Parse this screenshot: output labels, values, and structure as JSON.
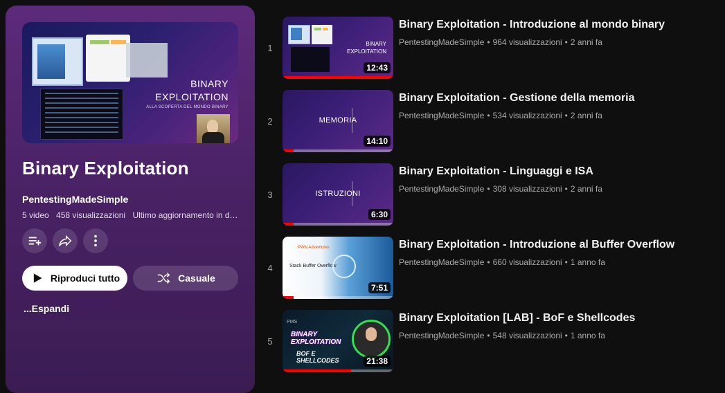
{
  "playlist": {
    "title": "Binary Exploitation",
    "channel": "PentestingMadeSimple",
    "video_count": "5 video",
    "views": "458 visualizzazioni",
    "updated": "Ultimo aggiornamento in da...",
    "thumb_title_line1": "BINARY",
    "thumb_title_line2": "EXPLOITATION",
    "thumb_subtitle": "ALLA SCOPERTA DEL MONDO BINARY",
    "actions": {
      "save_icon": "playlist-add-icon",
      "share_icon": "share-icon",
      "more_icon": "more-vert-icon"
    },
    "play_all_label": "Riproduci tutto",
    "shuffle_label": "Casuale",
    "expand_label": "...Espandi"
  },
  "videos": [
    {
      "index": "1",
      "title": "Binary Exploitation - Introduzione al mondo binary",
      "channel": "PentestingMadeSimple",
      "views": "964 visualizzazioni",
      "age": "2 anni fa",
      "duration": "12:43",
      "progress": 1.0,
      "thumb_label_1": "BINARY",
      "thumb_label_2": "EXPLOITATION"
    },
    {
      "index": "2",
      "title": "Binary Exploitation - Gestione della memoria",
      "channel": "PentestingMadeSimple",
      "views": "534 visualizzazioni",
      "age": "2 anni fa",
      "duration": "14:10",
      "progress": 0.1,
      "thumb_label": "MEMORIA"
    },
    {
      "index": "3",
      "title": "Binary Exploitation - Linguaggi e ISA",
      "channel": "PentestingMadeSimple",
      "views": "308 visualizzazioni",
      "age": "2 anni fa",
      "duration": "6:30",
      "progress": 0.1,
      "thumb_label": "ISTRUZIONI"
    },
    {
      "index": "4",
      "title": "Binary Exploitation - Introduzione al Buffer Overflow",
      "channel": "PentestingMadeSimple",
      "views": "660 visualizzazioni",
      "age": "1 anno fa",
      "duration": "7:51",
      "progress": 0.1,
      "thumb_label_1": "PWN Adventures",
      "thumb_label_2": "Stack Buffer Overflow"
    },
    {
      "index": "5",
      "title": "Binary Exploitation [LAB] - BoF e Shellcodes",
      "channel": "PentestingMadeSimple",
      "views": "548 visualizzazioni",
      "age": "1 anno fa",
      "duration": "21:38",
      "progress": 0.62,
      "thumb_label_1": "PMS",
      "thumb_label_2": "BINARY EXPLOITATION",
      "thumb_label_3": "BOF E SHELLCODES"
    }
  ],
  "meta_separator": "•",
  "colors": {
    "panel": "#4a2266",
    "progress": "#ff0000",
    "background": "#0f0f0f"
  }
}
